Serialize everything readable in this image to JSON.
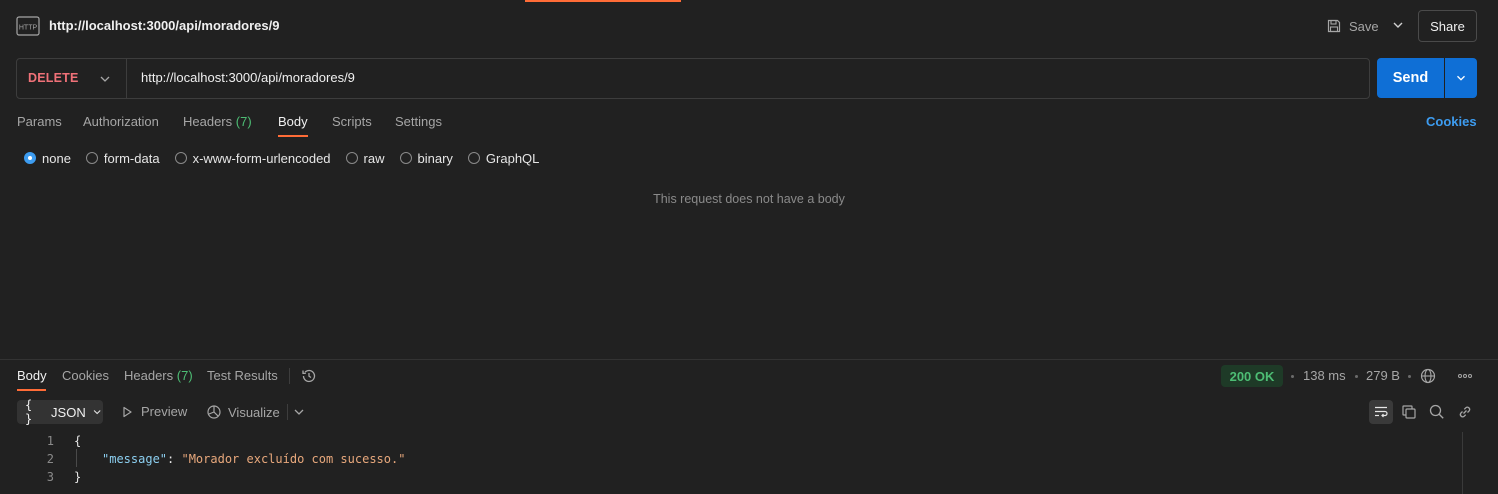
{
  "header": {
    "icon_label": "HTTP",
    "title": "http://localhost:3000/api/moradores/9",
    "save_label": "Save",
    "share_label": "Share"
  },
  "request": {
    "method": "DELETE",
    "url": "http://localhost:3000/api/moradores/9",
    "send_label": "Send",
    "tabs": [
      {
        "label": "Params",
        "count": ""
      },
      {
        "label": "Authorization",
        "count": ""
      },
      {
        "label": "Headers",
        "count": "(7)"
      },
      {
        "label": "Body",
        "count": ""
      },
      {
        "label": "Scripts",
        "count": ""
      },
      {
        "label": "Settings",
        "count": ""
      }
    ],
    "active_tab": "Body",
    "cookies_label": "Cookies",
    "body_types": [
      "none",
      "form-data",
      "x-www-form-urlencoded",
      "raw",
      "binary",
      "GraphQL"
    ],
    "selected_body_type": "none",
    "empty_message": "This request does not have a body"
  },
  "response": {
    "tabs": [
      {
        "label": "Body",
        "count": ""
      },
      {
        "label": "Cookies",
        "count": ""
      },
      {
        "label": "Headers",
        "count": "(7)"
      },
      {
        "label": "Test Results",
        "count": ""
      }
    ],
    "active_tab": "Body",
    "status": "200 OK",
    "time": "138 ms",
    "size": "279 B",
    "format": "JSON",
    "format_braces": "{ }",
    "preview_label": "Preview",
    "visualize_label": "Visualize",
    "code": {
      "line_numbers": [
        "1",
        "2",
        "3"
      ],
      "open_brace": "{",
      "key": "\"message\"",
      "colon": ": ",
      "value": "\"Morador excluído com sucesso.\"",
      "close_brace": "}"
    }
  },
  "colors": {
    "accent": "#ff6c37",
    "send": "#0f6fd6",
    "method_delete": "#f07178",
    "status_ok": "#4dbd74",
    "link": "#3d9cf0"
  }
}
